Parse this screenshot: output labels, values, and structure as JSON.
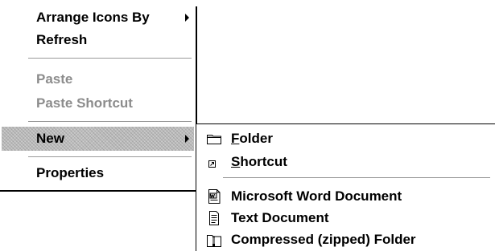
{
  "main_menu": {
    "items": [
      {
        "label": "Arrange Icons By"
      },
      {
        "label": "Refresh"
      },
      {
        "label": "Paste"
      },
      {
        "label": "Paste Shortcut"
      },
      {
        "label": "New"
      },
      {
        "label": "Properties"
      }
    ]
  },
  "new_submenu": {
    "folder": {
      "accel": "F",
      "rest": "older"
    },
    "shortcut": {
      "accel": "S",
      "rest": "hortcut"
    },
    "items": [
      {
        "label": "Microsoft Word Document",
        "icon": "word-document-icon"
      },
      {
        "label": "Text Document",
        "icon": "text-document-icon"
      },
      {
        "label": "Compressed (zipped) Folder",
        "icon": "zip-folder-icon"
      }
    ]
  },
  "colors": {
    "highlight": "#bdbdbd",
    "disabled_text": "#8c8c8c",
    "separator": "#9a9a9a"
  }
}
